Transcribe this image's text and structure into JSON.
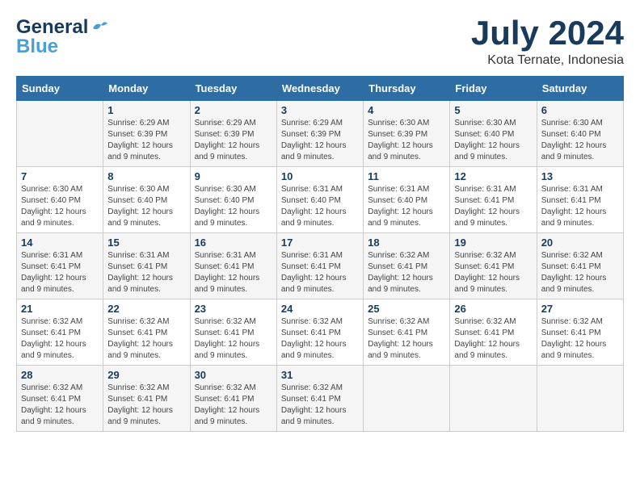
{
  "header": {
    "logo_line1": "General",
    "logo_line2": "Blue",
    "month": "July 2024",
    "location": "Kota Ternate, Indonesia"
  },
  "days_of_week": [
    "Sunday",
    "Monday",
    "Tuesday",
    "Wednesday",
    "Thursday",
    "Friday",
    "Saturday"
  ],
  "weeks": [
    [
      {
        "day": "",
        "info": ""
      },
      {
        "day": "1",
        "info": "Sunrise: 6:29 AM\nSunset: 6:39 PM\nDaylight: 12 hours\nand 9 minutes."
      },
      {
        "day": "2",
        "info": "Sunrise: 6:29 AM\nSunset: 6:39 PM\nDaylight: 12 hours\nand 9 minutes."
      },
      {
        "day": "3",
        "info": "Sunrise: 6:29 AM\nSunset: 6:39 PM\nDaylight: 12 hours\nand 9 minutes."
      },
      {
        "day": "4",
        "info": "Sunrise: 6:30 AM\nSunset: 6:39 PM\nDaylight: 12 hours\nand 9 minutes."
      },
      {
        "day": "5",
        "info": "Sunrise: 6:30 AM\nSunset: 6:40 PM\nDaylight: 12 hours\nand 9 minutes."
      },
      {
        "day": "6",
        "info": "Sunrise: 6:30 AM\nSunset: 6:40 PM\nDaylight: 12 hours\nand 9 minutes."
      }
    ],
    [
      {
        "day": "7",
        "info": "Sunrise: 6:30 AM\nSunset: 6:40 PM\nDaylight: 12 hours\nand 9 minutes."
      },
      {
        "day": "8",
        "info": "Sunrise: 6:30 AM\nSunset: 6:40 PM\nDaylight: 12 hours\nand 9 minutes."
      },
      {
        "day": "9",
        "info": "Sunrise: 6:30 AM\nSunset: 6:40 PM\nDaylight: 12 hours\nand 9 minutes."
      },
      {
        "day": "10",
        "info": "Sunrise: 6:31 AM\nSunset: 6:40 PM\nDaylight: 12 hours\nand 9 minutes."
      },
      {
        "day": "11",
        "info": "Sunrise: 6:31 AM\nSunset: 6:40 PM\nDaylight: 12 hours\nand 9 minutes."
      },
      {
        "day": "12",
        "info": "Sunrise: 6:31 AM\nSunset: 6:41 PM\nDaylight: 12 hours\nand 9 minutes."
      },
      {
        "day": "13",
        "info": "Sunrise: 6:31 AM\nSunset: 6:41 PM\nDaylight: 12 hours\nand 9 minutes."
      }
    ],
    [
      {
        "day": "14",
        "info": "Sunrise: 6:31 AM\nSunset: 6:41 PM\nDaylight: 12 hours\nand 9 minutes."
      },
      {
        "day": "15",
        "info": "Sunrise: 6:31 AM\nSunset: 6:41 PM\nDaylight: 12 hours\nand 9 minutes."
      },
      {
        "day": "16",
        "info": "Sunrise: 6:31 AM\nSunset: 6:41 PM\nDaylight: 12 hours\nand 9 minutes."
      },
      {
        "day": "17",
        "info": "Sunrise: 6:31 AM\nSunset: 6:41 PM\nDaylight: 12 hours\nand 9 minutes."
      },
      {
        "day": "18",
        "info": "Sunrise: 6:32 AM\nSunset: 6:41 PM\nDaylight: 12 hours\nand 9 minutes."
      },
      {
        "day": "19",
        "info": "Sunrise: 6:32 AM\nSunset: 6:41 PM\nDaylight: 12 hours\nand 9 minutes."
      },
      {
        "day": "20",
        "info": "Sunrise: 6:32 AM\nSunset: 6:41 PM\nDaylight: 12 hours\nand 9 minutes."
      }
    ],
    [
      {
        "day": "21",
        "info": "Sunrise: 6:32 AM\nSunset: 6:41 PM\nDaylight: 12 hours\nand 9 minutes."
      },
      {
        "day": "22",
        "info": "Sunrise: 6:32 AM\nSunset: 6:41 PM\nDaylight: 12 hours\nand 9 minutes."
      },
      {
        "day": "23",
        "info": "Sunrise: 6:32 AM\nSunset: 6:41 PM\nDaylight: 12 hours\nand 9 minutes."
      },
      {
        "day": "24",
        "info": "Sunrise: 6:32 AM\nSunset: 6:41 PM\nDaylight: 12 hours\nand 9 minutes."
      },
      {
        "day": "25",
        "info": "Sunrise: 6:32 AM\nSunset: 6:41 PM\nDaylight: 12 hours\nand 9 minutes."
      },
      {
        "day": "26",
        "info": "Sunrise: 6:32 AM\nSunset: 6:41 PM\nDaylight: 12 hours\nand 9 minutes."
      },
      {
        "day": "27",
        "info": "Sunrise: 6:32 AM\nSunset: 6:41 PM\nDaylight: 12 hours\nand 9 minutes."
      }
    ],
    [
      {
        "day": "28",
        "info": "Sunrise: 6:32 AM\nSunset: 6:41 PM\nDaylight: 12 hours\nand 9 minutes."
      },
      {
        "day": "29",
        "info": "Sunrise: 6:32 AM\nSunset: 6:41 PM\nDaylight: 12 hours\nand 9 minutes."
      },
      {
        "day": "30",
        "info": "Sunrise: 6:32 AM\nSunset: 6:41 PM\nDaylight: 12 hours\nand 9 minutes."
      },
      {
        "day": "31",
        "info": "Sunrise: 6:32 AM\nSunset: 6:41 PM\nDaylight: 12 hours\nand 9 minutes."
      },
      {
        "day": "",
        "info": ""
      },
      {
        "day": "",
        "info": ""
      },
      {
        "day": "",
        "info": ""
      }
    ]
  ]
}
